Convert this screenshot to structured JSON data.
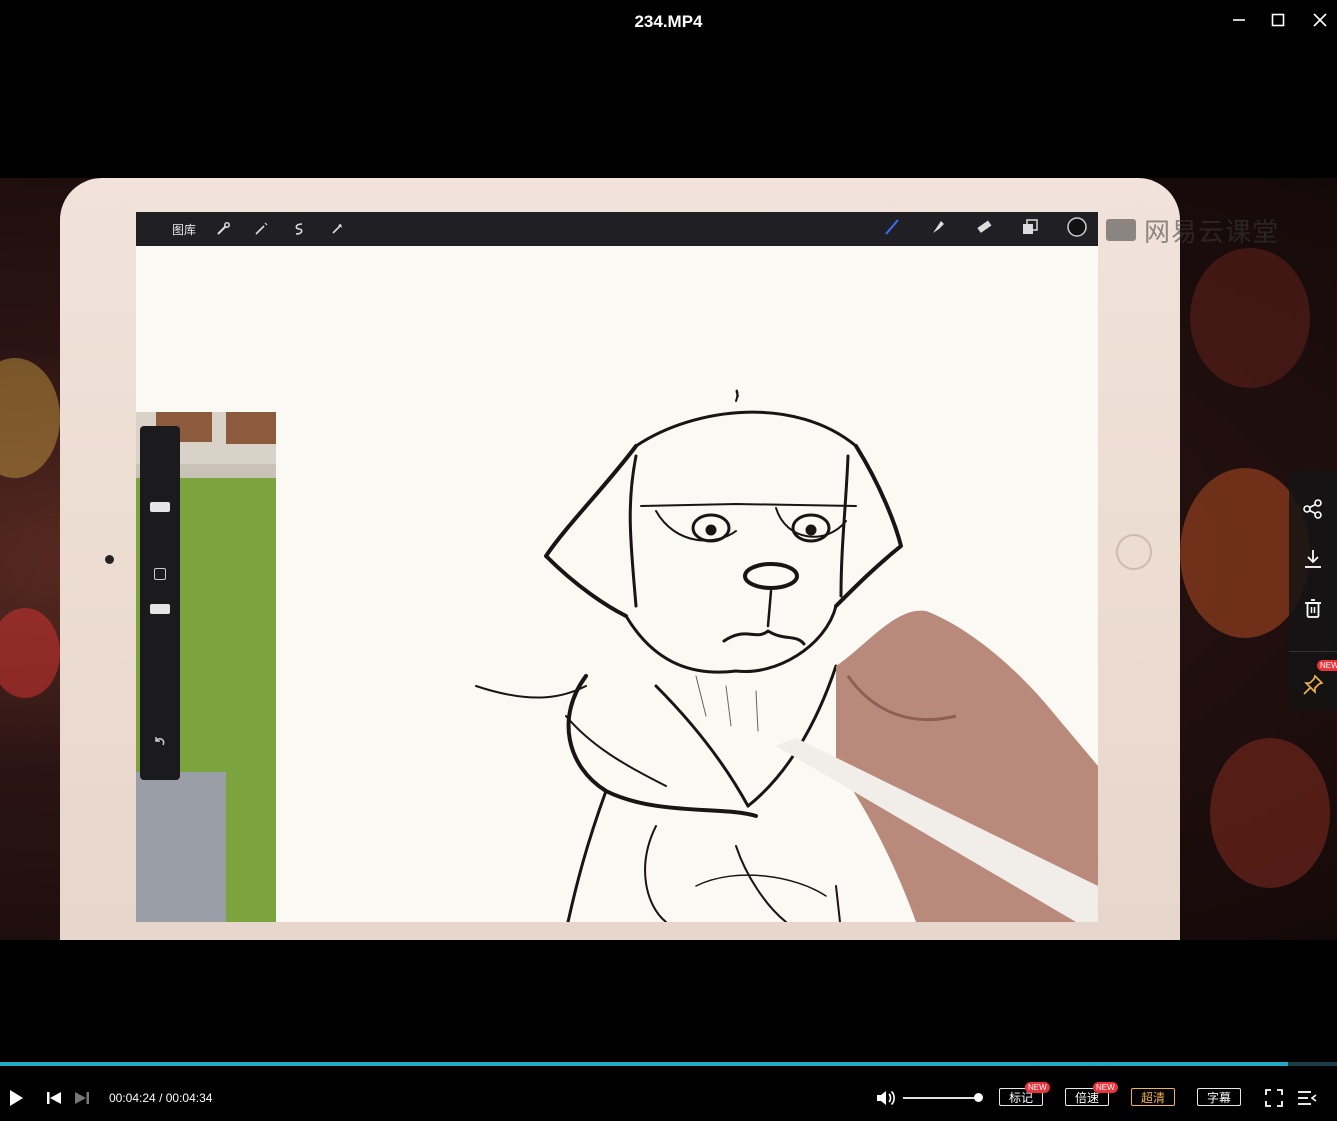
{
  "window": {
    "title": "234.MP4",
    "minimize_icon": "minimize-icon",
    "maximize_icon": "maximize-icon",
    "close_icon": "close-icon"
  },
  "video": {
    "app_toolbar": {
      "gallery_label": "图库",
      "icons": [
        "wrench-icon",
        "magic-wand-icon",
        "selection-icon",
        "arrow-icon"
      ],
      "right_icons": [
        "brush-icon",
        "smudge-icon",
        "eraser-icon",
        "layers-icon",
        "color-icon"
      ],
      "accent_color": "#3b6cf6"
    },
    "watermark": "网易云课堂"
  },
  "side_panel": {
    "items": [
      {
        "name": "share",
        "icon": "share-icon"
      },
      {
        "name": "download",
        "icon": "download-icon"
      },
      {
        "name": "delete",
        "icon": "trash-icon"
      },
      {
        "name": "pin",
        "icon": "pin-icon",
        "badge": "NEW"
      }
    ]
  },
  "player": {
    "progress_fraction": 0.9636,
    "current_time": "00:04:24",
    "separator": "/",
    "total_time": "00:04:34",
    "volume_fraction": 1.0,
    "buttons": {
      "mark": "标记",
      "mark_badge": "NEW",
      "speed": "倍速",
      "speed_badge": "NEW",
      "quality": "超清",
      "subtitle": "字幕"
    },
    "accent_color": "#20a8c4",
    "quality_color": "#f3b44a"
  }
}
